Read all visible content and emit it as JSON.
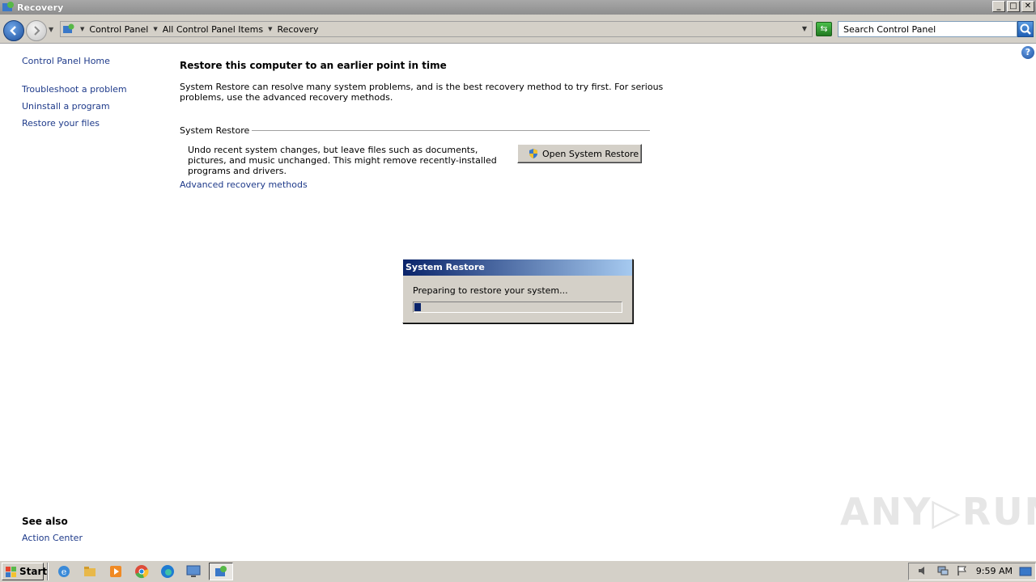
{
  "window": {
    "title": "Recovery"
  },
  "window_buttons": {
    "minimize": "_",
    "maximize": "□",
    "close": "✕"
  },
  "address_bar": {
    "breadcrumbs": [
      "Control Panel",
      "All Control Panel Items",
      "Recovery"
    ]
  },
  "search": {
    "placeholder": "Search Control Panel"
  },
  "sidebar": {
    "home": "Control Panel Home",
    "links": [
      "Troubleshoot a problem",
      "Uninstall a program",
      "Restore your files"
    ],
    "see_also_heading": "See also",
    "see_also_links": [
      "Action Center"
    ]
  },
  "main": {
    "title": "Restore this computer to an earlier point in time",
    "description": "System Restore can resolve many system problems, and is the best recovery method to try first. For serious problems, use the advanced recovery methods.",
    "section_heading": "System Restore",
    "section_description": "Undo recent system changes, but leave files such as documents, pictures, and music unchanged. This might remove recently-installed programs and drivers.",
    "open_button": "Open System Restore",
    "advanced_link": "Advanced recovery methods"
  },
  "dialog": {
    "title": "System Restore",
    "message": "Preparing to restore your system...",
    "progress_fraction": 0.03
  },
  "watermark": {
    "text": "ANY▷RUN"
  },
  "taskbar": {
    "start_label": "Start",
    "clock": "9:59 AM",
    "items": [
      "internet-explorer-icon",
      "file-explorer-icon",
      "media-player-icon",
      "chrome-icon",
      "edge-icon",
      "remote-desktop-icon",
      "control-panel-icon"
    ]
  },
  "colors": {
    "link": "#1e3a8a",
    "dialog_title_start": "#0a246a",
    "dialog_title_end": "#a6caf0",
    "progress_fill": "#0a246a",
    "chrome": "#d4d0c8"
  }
}
